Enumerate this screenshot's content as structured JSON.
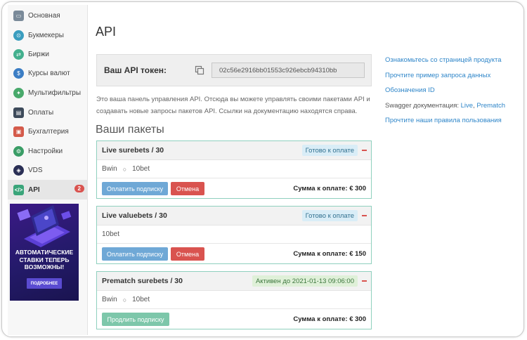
{
  "sidebar": {
    "items": [
      {
        "label": "Основная",
        "icon": "home-icon",
        "color": "#7a8a99"
      },
      {
        "label": "Букмекеры",
        "icon": "bookmakers-icon",
        "color": "#3a9dbf"
      },
      {
        "label": "Биржи",
        "icon": "exchange-icon",
        "color": "#43b08e"
      },
      {
        "label": "Курсы валют",
        "icon": "currency-icon",
        "color": "#3b7dc4"
      },
      {
        "label": "Мультифильтры",
        "icon": "multifilter-icon",
        "color": "#48a96b"
      },
      {
        "label": "Оплаты",
        "icon": "payments-icon",
        "color": "#3d4a5a"
      },
      {
        "label": "Бухгалтерия",
        "icon": "accounting-icon",
        "color": "#d45a4a"
      },
      {
        "label": "Настройки",
        "icon": "settings-icon",
        "color": "#3a9d66"
      },
      {
        "label": "VDS",
        "icon": "vds-icon",
        "color": "#2a2f55"
      },
      {
        "label": "API",
        "icon": "api-icon",
        "color": "#3aa57a",
        "badge": "2"
      }
    ],
    "promo": {
      "text": "АВТОМАТИЧЕСКИЕ СТАВКИ ТЕПЕРЬ ВОЗМОЖНЫ!",
      "button": "ПОДРОБНЕЕ"
    }
  },
  "main": {
    "title": "API",
    "token_label": "Ваш API токен:",
    "token_value": "02c56e2916bb01553c926ebcb94310bb",
    "description": "Это ваша панель управления API. Отсюда вы можете управлять своими пакетами API и создавать новые запросы пакетов API. Ссылки на документацию находятся справа.",
    "packages_title": "Ваши пакеты",
    "packages": [
      {
        "title": "Live surebets / 30",
        "status": "Готово к оплате",
        "items": [
          "Bwin",
          "10bet"
        ],
        "primary_button": "Оплатить подписку",
        "cancel_button": "Отмена",
        "sum": "Сумма к оплате: € 300"
      },
      {
        "title": "Live valuebets / 30",
        "status": "Готово к оплате",
        "items": [
          "10bet"
        ],
        "primary_button": "Оплатить подписку",
        "cancel_button": "Отмена",
        "sum": "Сумма к оплате: € 150"
      },
      {
        "title": "Prematch surebets / 30",
        "status": "Активен до 2021-01-13 09:06:00",
        "items": [
          "Bwin",
          "10bet"
        ],
        "primary_button": "Продлить подписку",
        "sum": "Сумма к оплате: € 300"
      }
    ]
  },
  "links": {
    "product_page": "Ознакомьтесь со страницей продукта",
    "data_example": "Прочтите пример запроса данных",
    "id_meanings": "Обозначения ID",
    "swagger_label": "Swagger документация:",
    "swagger_live": "Live",
    "swagger_comma": ",",
    "swagger_prematch": "Prematch",
    "rules": "Прочтите наши правила пользования"
  }
}
